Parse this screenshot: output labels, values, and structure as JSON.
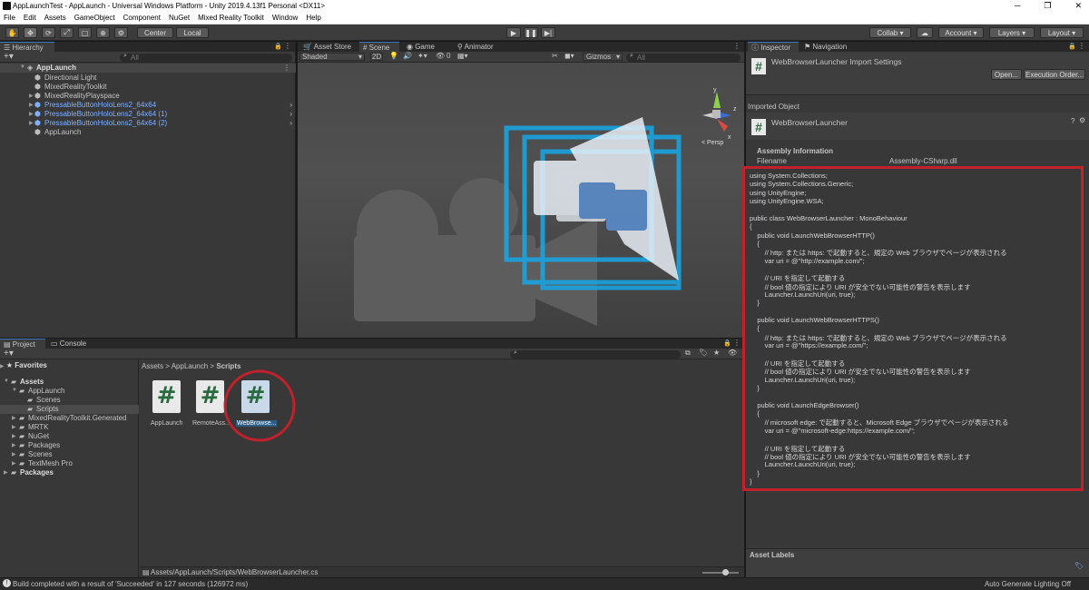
{
  "window": {
    "title": "AppLaunchTest - AppLaunch - Universal Windows Platform - Unity 2019.4.13f1 Personal <DX11>"
  },
  "menu": [
    "File",
    "Edit",
    "Assets",
    "GameObject",
    "Component",
    "NuGet",
    "Mixed Reality Toolkit",
    "Window",
    "Help"
  ],
  "toolbar": {
    "center_label": "Center",
    "local_label": "Local",
    "collab_label": "Collab",
    "account_label": "Account",
    "layers_label": "Layers",
    "layout_label": "Layout"
  },
  "hierarchy": {
    "tab": "Hierarchy",
    "search_placeholder": "All",
    "root": "AppLaunch",
    "items": [
      {
        "label": "Directional Light",
        "color": "normal"
      },
      {
        "label": "MixedRealityToolkit",
        "color": "normal"
      },
      {
        "label": "MixedRealityPlayspace",
        "color": "normal"
      },
      {
        "label": "PressableButtonHoloLens2_64x64",
        "color": "blue"
      },
      {
        "label": "PressableButtonHoloLens2_64x64 (1)",
        "color": "blue"
      },
      {
        "label": "PressableButtonHoloLens2_64x64 (2)",
        "color": "blue"
      },
      {
        "label": "AppLaunch",
        "color": "normal"
      }
    ]
  },
  "scene": {
    "tabs": [
      "Asset Store",
      "Scene",
      "Game",
      "Animator"
    ],
    "shading": "Shaded",
    "mode2d": "2D",
    "fx_count": "0",
    "gizmos": "Gizmos",
    "search_placeholder": "All",
    "persp": "< Persp",
    "axis_y": "y",
    "axis_z": "z",
    "axis_x": "x"
  },
  "project": {
    "tabs": [
      "Project",
      "Console"
    ],
    "breadcrumb": [
      "Assets",
      "AppLaunch",
      "Scripts"
    ],
    "favorites": "Favorites",
    "tree": [
      {
        "label": "Assets",
        "level": 0,
        "bold": true
      },
      {
        "label": "AppLaunch",
        "level": 1
      },
      {
        "label": "Scenes",
        "level": 2
      },
      {
        "label": "Scripts",
        "level": 2
      },
      {
        "label": "MixedRealityToolkit.Generated",
        "level": 1
      },
      {
        "label": "MRTK",
        "level": 1
      },
      {
        "label": "NuGet",
        "level": 1
      },
      {
        "label": "Packages",
        "level": 1
      },
      {
        "label": "Scenes",
        "level": 1
      },
      {
        "label": "TextMesh Pro",
        "level": 1
      },
      {
        "label": "Packages",
        "level": 0,
        "bold": true
      }
    ],
    "assets": [
      {
        "label": "AppLaunch"
      },
      {
        "label": "RemoteAss..."
      },
      {
        "label": "WebBrowse..."
      }
    ],
    "path": "Assets/AppLaunch/Scripts/WebBrowserLauncher.cs"
  },
  "inspector": {
    "tabs": [
      "Inspector",
      "Navigation"
    ],
    "import_title": "WebBrowserLauncher Import Settings",
    "open_label": "Open...",
    "exec_label": "Execution Order...",
    "imported_object": "Imported Object",
    "object_name": "WebBrowserLauncher",
    "assembly_info": "Assembly Information",
    "filename_label": "Filename",
    "filename_value": "Assembly-CSharp.dll",
    "asset_labels": "Asset Labels",
    "code": [
      "using System.Collections;",
      "using System.Collections.Generic;",
      "using UnityEngine;",
      "using UnityEngine.WSA;",
      "",
      "public class WebBrowserLauncher : MonoBehaviour",
      "{",
      "    public void LaunchWebBrowserHTTP()",
      "    {",
      "        // http: または https: で起動すると、規定の Web ブラウザでページが表示される",
      "        var uri = @\"http://example.com/\";",
      "",
      "        // URI を指定して起動する",
      "        // bool 値の指定により URI が安全でない可能性の警告を表示します",
      "        Launcher.LaunchUri(uri, true);",
      "    }",
      "",
      "    public void LaunchWebBrowserHTTPS()",
      "    {",
      "        // http: または https: で起動すると、規定の Web ブラウザでページが表示される",
      "        var uri = @\"https://example.com/\";",
      "",
      "        // URI を指定して起動する",
      "        // bool 値の指定により URI が安全でない可能性の警告を表示します",
      "        Launcher.LaunchUri(uri, true);",
      "    }",
      "",
      "    public void LaunchEdgeBrowser()",
      "    {",
      "        // microsoft edge: で起動すると、Microsoft Edge ブラウザでページが表示される",
      "        var uri = @\"microsoft-edge:https://example.com/\";",
      "",
      "        // URI を指定して起動する",
      "        // bool 値の指定により URI が安全でない可能性の警告を表示します",
      "        Launcher.LaunchUri(uri, true);",
      "    }",
      "}"
    ]
  },
  "status": {
    "message": "Build completed with a result of 'Succeeded' in 127 seconds (126972 ms)",
    "right": "Auto Generate Lighting Off"
  },
  "colors": {
    "highlight_circle": "#c0212a",
    "selection": "#2c5d87",
    "prefab_blue": "#7fb0ff"
  }
}
